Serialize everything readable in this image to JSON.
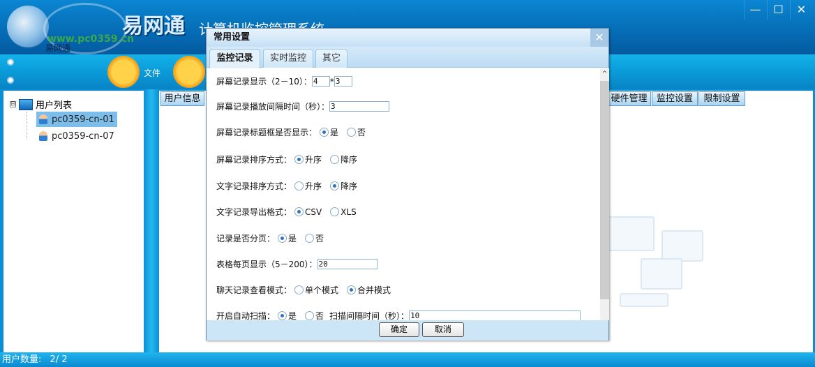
{
  "header": {
    "brand": "易网通",
    "subtitle": "计算机监控管理系统",
    "watermark": "www.pc0359.cn",
    "logo_text": "易网通"
  },
  "window": {
    "minimize": "—",
    "maximize": "☐",
    "close": "✕"
  },
  "toolbar": {
    "file_label": "文件"
  },
  "tree": {
    "root": "用户列表",
    "expander": "⊟",
    "nodes": [
      "pc0359-cn-01",
      "pc0359-cn-07"
    ]
  },
  "main_tabs": [
    "用户信息",
    "硬件管理",
    "监控设置",
    "限制设置"
  ],
  "status": {
    "label": "用户数量:",
    "value": "2/ 2"
  },
  "dialog": {
    "title": "常用设置",
    "close": "✕",
    "tabs": [
      "监控记录",
      "实时监控",
      "其它"
    ],
    "rows": {
      "screen_grid": {
        "label": "屏幕记录显示（2－10）：",
        "cols": "4",
        "sep": "*",
        "rows": "3"
      },
      "interval": {
        "label": "屏幕记录播放间隔时间（秒）：",
        "value": "3"
      },
      "title_bar": {
        "label": "屏幕记录标题框是否显示：",
        "options": [
          "是",
          "否"
        ],
        "selected": 0
      },
      "screen_sort": {
        "label": "屏幕记录排序方式：",
        "options": [
          "升序",
          "降序"
        ],
        "selected": 0
      },
      "text_sort": {
        "label": "文字记录排序方式：",
        "options": [
          "升序",
          "降序"
        ],
        "selected": 1
      },
      "export": {
        "label": "文字记录导出格式：",
        "options": [
          "CSV",
          "XLS"
        ],
        "selected": 0
      },
      "paging": {
        "label": "记录是否分页：",
        "options": [
          "是",
          "否"
        ],
        "selected": 0
      },
      "per_page": {
        "label": "表格每页显示（5－200）：",
        "value": "20"
      },
      "chat_mode": {
        "label": "聊天记录查看模式：",
        "options": [
          "单个模式",
          "合并模式"
        ],
        "selected": 1
      },
      "auto_scan": {
        "label": "开启自动扫描：",
        "options": [
          "是",
          "否"
        ],
        "selected": 0,
        "interval_label": "扫描间隔时间（秒）：",
        "interval": "10"
      }
    },
    "ok": "确定",
    "cancel": "取消",
    "scroll_up": "^"
  }
}
